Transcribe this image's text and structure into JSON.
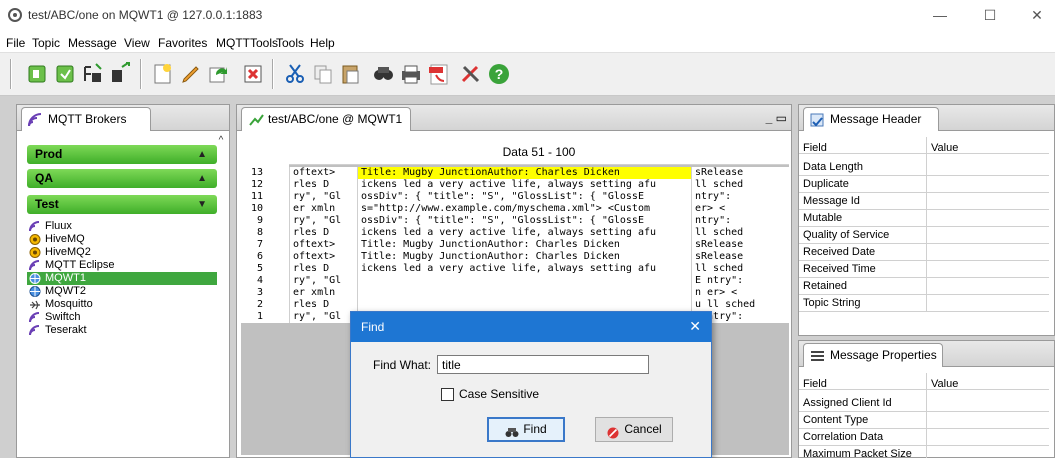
{
  "window": {
    "title": "test/ABC/one on MQWT1 @ 127.0.0.1:1883",
    "minimize": "—",
    "maximize": "☐",
    "close": "✕"
  },
  "menu": [
    "File",
    "Topic",
    "Message",
    "View",
    "Favorites",
    "MQTTTools",
    "Tools",
    "Help"
  ],
  "toolbar": {
    "icons": [
      "connect-icon",
      "disconnect-icon",
      "subscribe-icon",
      "unsubscribe-icon",
      "new-message-icon",
      "edit-icon",
      "refresh-icon",
      "delete-icon",
      "cut-icon",
      "copy-icon",
      "paste-icon",
      "find-icon",
      "print-icon",
      "pdf-icon",
      "tools-icon",
      "help-icon"
    ]
  },
  "brokers": {
    "tab": "MQTT Brokers",
    "groups": [
      {
        "label": "Prod",
        "arrow": "▲"
      },
      {
        "label": "QA",
        "arrow": "▲"
      },
      {
        "label": "Test",
        "arrow": "▼"
      }
    ],
    "items": [
      {
        "label": "Fluux",
        "icon": "fluux-icon"
      },
      {
        "label": "HiveMQ",
        "icon": "hivemq-icon"
      },
      {
        "label": "HiveMQ2",
        "icon": "hivemq-icon"
      },
      {
        "label": "MQTT Eclipse",
        "icon": "eclipse-icon"
      },
      {
        "label": "MQWT1",
        "icon": "mqwt-icon",
        "selected": true
      },
      {
        "label": "MQWT2",
        "icon": "mqwt-icon"
      },
      {
        "label": "Mosquitto",
        "icon": "mosquitto-icon"
      },
      {
        "label": "Swiftch",
        "icon": "swiftch-icon"
      },
      {
        "label": "Teserakt",
        "icon": "teserakt-icon"
      }
    ],
    "scroll_up": "^"
  },
  "message_panel": {
    "tab": "test/ABC/one @ MQWT1",
    "tab_close": "✕",
    "controls": "_ ▭",
    "header": "Data 51 - 100",
    "rows": [
      {
        "n": "13",
        "c1": "oftext>",
        "c2": "Title:  Mugby JunctionAuthor:  Charles Dicken",
        "c3": "sRelease",
        "hl": true
      },
      {
        "n": "12",
        "c1": "rles D",
        "c2": "ickens led a very active life, always setting afu",
        "c3": "ll sched"
      },
      {
        "n": "11",
        "c1": "ry\", \"Gl",
        "c2": "ossDiv\":  { \"title\":  \"S\", \"GlossList\":  { \"GlossE",
        "c3": "ntry\":"
      },
      {
        "n": "10",
        "c1": "er xmln",
        "c2": "s=\"http://www.example.com/myschema.xml\">  <Custom",
        "c3": "er>    <"
      },
      {
        "n": "9",
        "c1": "ry\", \"Gl",
        "c2": "ossDiv\":  { \"title\":  \"S\", \"GlossList\":  { \"GlossE",
        "c3": "ntry\":"
      },
      {
        "n": "8",
        "c1": "rles D",
        "c2": "ickens led a very active life, always setting afu",
        "c3": "ll sched"
      },
      {
        "n": "7",
        "c1": "oftext>",
        "c2": "Title:  Mugby JunctionAuthor:  Charles Dicken",
        "c3": "sRelease"
      },
      {
        "n": "6",
        "c1": "oftext>",
        "c2": "Title:  Mugby JunctionAuthor:  Charles Dicken",
        "c3": "sRelease"
      },
      {
        "n": "5",
        "c1": "rles D",
        "c2": "ickens led a very active life, always setting afu",
        "c3": "ll sched"
      },
      {
        "n": "4",
        "c1": "ry\", \"Gl",
        "c2": "",
        "c3": "E ntry\":"
      },
      {
        "n": "3",
        "c1": "er xmln",
        "c2": "",
        "c3": "n er>    <"
      },
      {
        "n": "2",
        "c1": "rles D",
        "c2": "",
        "c3": "u ll sched"
      },
      {
        "n": "1",
        "c1": "ry\", \"Gl",
        "c2": "",
        "c3": "E ntry\":"
      }
    ]
  },
  "message_header": {
    "tab": "Message Header",
    "col_field": "Field",
    "col_value": "Value",
    "fields": [
      "Data Length",
      "Duplicate",
      "Message Id",
      "Mutable",
      "Quality of Service",
      "Received Date",
      "Received Time",
      "Retained",
      "Topic String"
    ]
  },
  "message_properties": {
    "tab": "Message Properties",
    "col_field": "Field",
    "col_value": "Value",
    "fields": [
      "Assigned Client Id",
      "Content Type",
      "Correlation Data",
      "Maximum Packet Size"
    ]
  },
  "find_dialog": {
    "title": "Find",
    "close": "✕",
    "find_what_label": "Find What:",
    "find_what_value": "title",
    "case_sensitive_label": "Case Sensitive",
    "case_sensitive": false,
    "find_button": "Find",
    "cancel_button": "Cancel"
  }
}
